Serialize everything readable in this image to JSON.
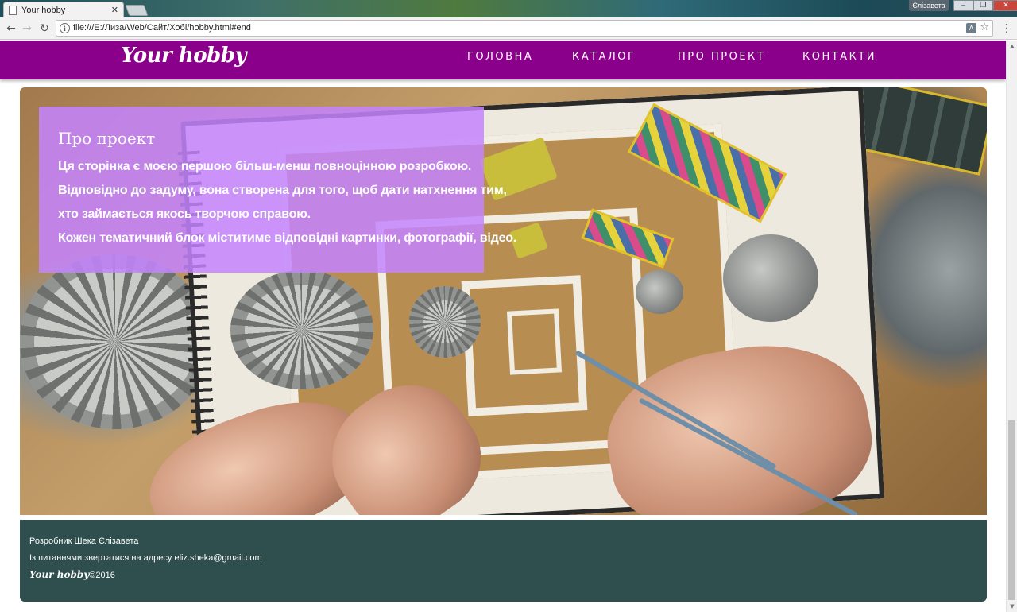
{
  "browser": {
    "tab_title": "Your hobby",
    "tab_close": "✕",
    "profile": "Єлізавета",
    "url": "file:///E:/Лиза/Web/Сайт/Хобі/hobby.html#end",
    "window_controls": [
      "‒",
      "❐",
      "✕"
    ]
  },
  "header": {
    "logo": "Your hobby",
    "nav": [
      "ГОЛОВНА",
      "КАТАЛОГ",
      "ПРО ПРОЕКТ",
      "КОНТАКТИ"
    ]
  },
  "about": {
    "title": "Про проект",
    "lines": [
      "Ця сторінка є моєю першою більш-менш повноцінною розробкою.",
      "Відповідно до задуму, вона створена для того, щоб дати натхнення тим,",
      "хто займається якось творчою справою.",
      "Кожен тематичний блок міститиме відповідні картинки, фотографії, відео."
    ]
  },
  "footer": {
    "developer": "Розробник Шека Єлізавета",
    "contact": "Із питаннями звертатися на адресу eliz.sheka@gmail.com",
    "logo": "Your hobby",
    "copyright": "©2016"
  },
  "colors": {
    "header_bg": "#8b008b",
    "about_box_bg": "#c484ff",
    "footer_bg": "#2f4f4f"
  }
}
